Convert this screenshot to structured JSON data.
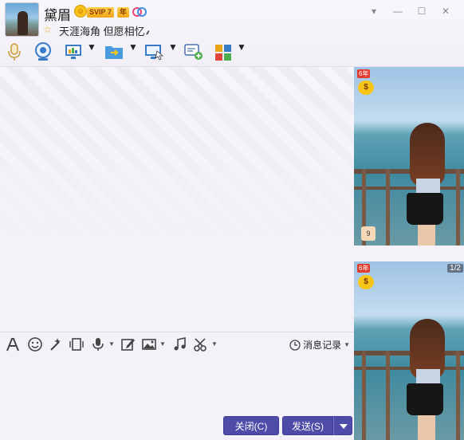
{
  "header": {
    "nickname": "黛眉",
    "vip_label": "SVIP 7",
    "year_label": "年",
    "signature": "天涯海角 但愿相忆",
    "signature_mark": "⸙"
  },
  "window_controls": {
    "dropdown": "▾",
    "minimize": "—",
    "maximize": "☐",
    "close": "✕"
  },
  "toolbar": {
    "items": [
      {
        "icon": "microphone-icon"
      },
      {
        "icon": "video-camera-icon"
      },
      {
        "icon": "screen-share-icon"
      },
      {
        "icon": "file-transfer-icon"
      },
      {
        "icon": "remote-desktop-icon"
      },
      {
        "icon": "group-chat-add-icon"
      },
      {
        "icon": "apps-grid-icon"
      }
    ]
  },
  "input_toolbar": {
    "history_label": "消息记录"
  },
  "buttons": {
    "close_label": "关闭(C)",
    "send_label": "发送(S)"
  },
  "side": {
    "badge_red": "6年",
    "badge_yellow": "$",
    "badge_small": "9",
    "page_indicator": "1/2"
  },
  "colors": {
    "button": "#4f4ca9",
    "background": "#f4f2f8",
    "vip": "#f0a416"
  }
}
